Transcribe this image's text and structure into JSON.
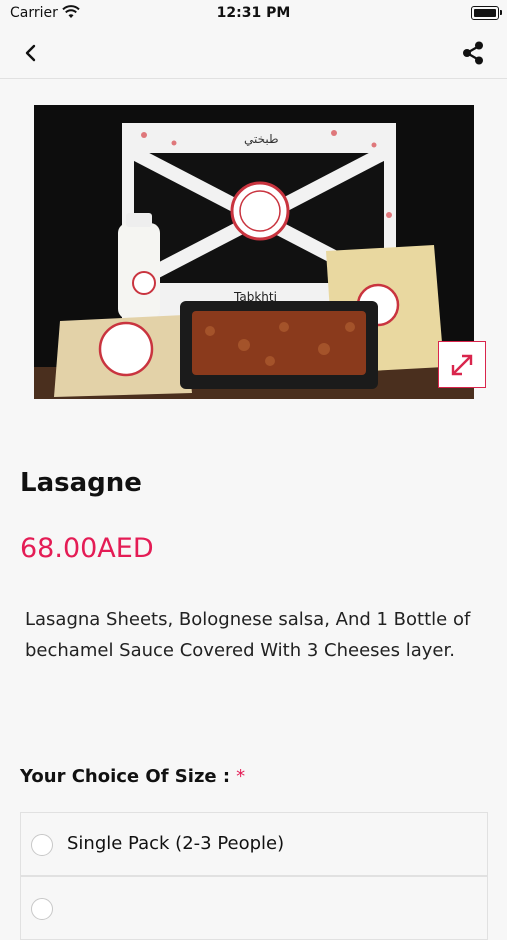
{
  "status_bar": {
    "carrier": "Carrier",
    "time": "12:31 PM"
  },
  "navigation": {
    "back_icon": "chevron-left-icon",
    "share_icon": "share-icon"
  },
  "product": {
    "image_alt_icon": "product-photo",
    "expand_icon": "expand-arrows-icon",
    "name": "Lasagne",
    "price": "68.00AED",
    "description": "Lasagna Sheets, Bolognese salsa, And 1 Bottle of bechamel Sauce Covered With 3 Cheeses layer.",
    "photo_brand_text": "Tabkhti",
    "photo_arabic_text": "طبختي"
  },
  "choice": {
    "label": "Your Choice Of Size :",
    "required_mark": "*",
    "options": [
      {
        "label": "Single Pack (2-3 People)"
      },
      {
        "label": ""
      }
    ]
  },
  "colors": {
    "accent": "#e41c55",
    "background": "#f7f7f7",
    "divider": "#e1e1e1"
  }
}
